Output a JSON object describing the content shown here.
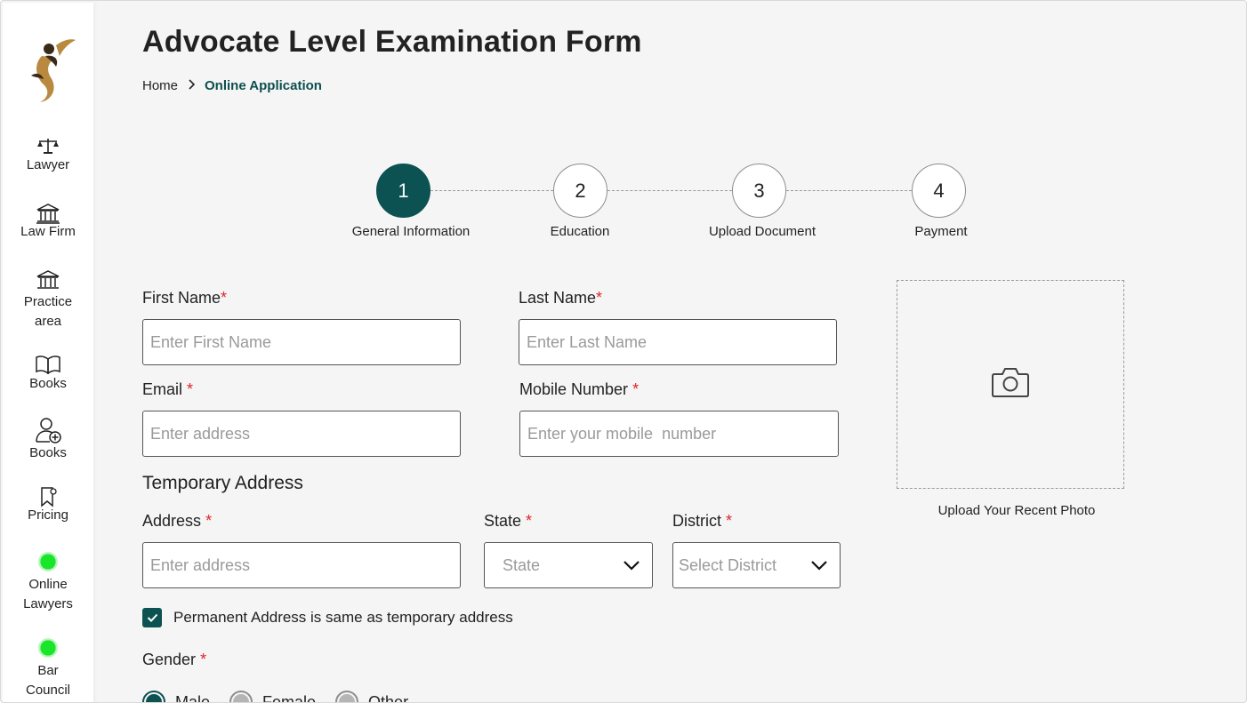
{
  "sidebar": {
    "items": [
      {
        "label": "Lawyer",
        "icon": "scales-icon"
      },
      {
        "label": "Law Firm",
        "icon": "building-icon"
      },
      {
        "label": "Practice area",
        "icon": "courthouse-icon"
      },
      {
        "label": "Books",
        "icon": "book-icon"
      },
      {
        "label": "Books",
        "icon": "add-user-icon"
      },
      {
        "label": "Pricing",
        "icon": "bookmark-icon"
      },
      {
        "label": "Online Lawyers",
        "icon": "online-dot-icon"
      },
      {
        "label": "Bar Council",
        "icon": "online-dot-icon"
      }
    ]
  },
  "header": {
    "title": "Advocate Level Examination Form",
    "breadcrumb": {
      "home": "Home",
      "current": "Online Application"
    }
  },
  "stepper": {
    "active_step": 1,
    "steps": [
      {
        "number": "1",
        "label": "General Information"
      },
      {
        "number": "2",
        "label": "Education"
      },
      {
        "number": "3",
        "label": "Upload Document"
      },
      {
        "number": "4",
        "label": "Payment"
      }
    ]
  },
  "form": {
    "first_name": {
      "label": "First Name",
      "required_mark": "*",
      "placeholder": "Enter First Name"
    },
    "last_name": {
      "label": "Last Name",
      "required_mark": "*",
      "placeholder": "Enter Last Name"
    },
    "email": {
      "label": "Email",
      "required_mark": "*",
      "placeholder": "Enter address"
    },
    "mobile": {
      "label": "Mobile Number",
      "required_mark": "*",
      "placeholder": "Enter your mobile  number"
    },
    "temporary_address_title": "Temporary Address",
    "address": {
      "label": "Address",
      "required_mark": "*",
      "placeholder": "Enter address"
    },
    "state": {
      "label": "State",
      "required_mark": "*",
      "value": "State"
    },
    "district": {
      "label": "District",
      "required_mark": "*",
      "value": "Select District"
    },
    "same_address": {
      "label": "Permanent Address is same as temporary address",
      "checked": true
    },
    "gender": {
      "label": "Gender",
      "required_mark": "*",
      "options": [
        "Male",
        "Female",
        "Other"
      ],
      "selected": "Male"
    }
  },
  "photo_upload": {
    "caption": "Upload Your Recent Photo",
    "icon": "camera-icon"
  },
  "colors": {
    "accent": "#0d5252",
    "required": "#e0242b",
    "online": "#19e52a"
  }
}
